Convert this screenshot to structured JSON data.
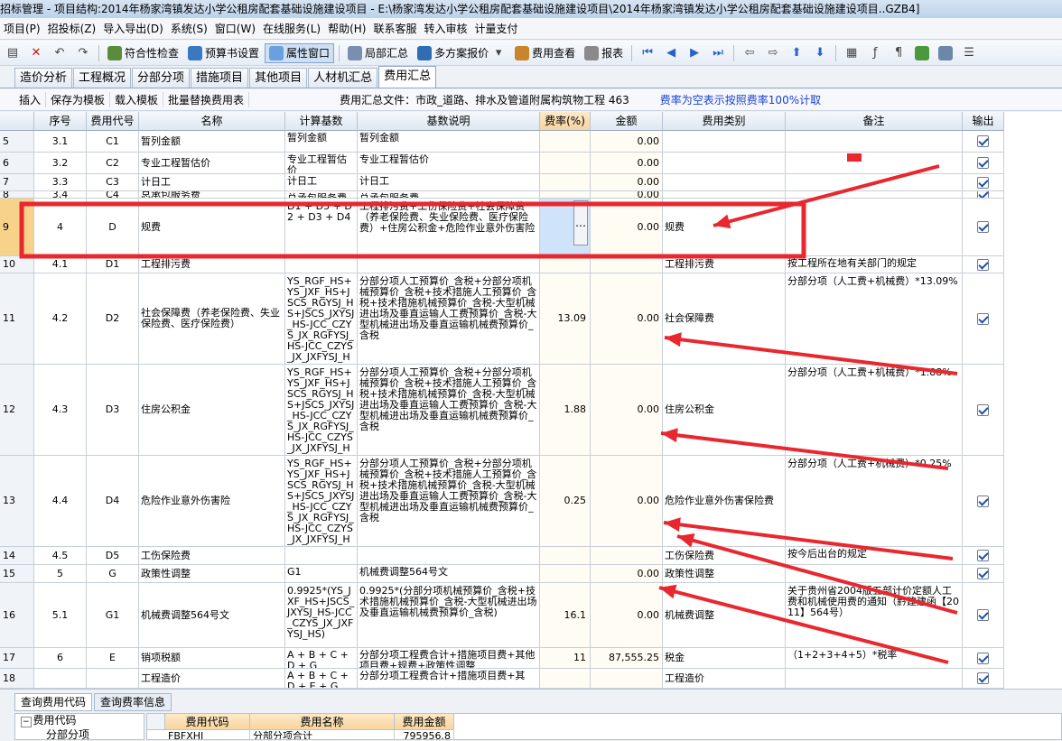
{
  "window_title": "招标管理 - 项目结构:2014年杨家湾镇发达小学公租房配套基础设施建设项目 - E:\\杨家湾发达小学公租房配套基础设施建设项目\\2014年杨家湾镇发达小学公租房配套基础设施建设项目..GZB4]",
  "menu": [
    "项目(P)",
    "招投标(Z)",
    "导入导出(D)",
    "系统(S)",
    "窗口(W)",
    "在线服务(L)",
    "帮助(H)",
    "联系客服",
    "转入审核",
    "计量支付"
  ],
  "toolbar": [
    "符合性检查",
    "预算书设置",
    "属性窗口",
    "局部汇总",
    "多方案报价",
    "费用查看",
    "报表"
  ],
  "tabs": [
    "造价分析",
    "工程概况",
    "分部分项",
    "措施项目",
    "其他项目",
    "人材机汇总",
    "费用汇总"
  ],
  "subbar": {
    "buttons": [
      "插入",
      "保存为模板",
      "载入模板",
      "批量替换费用表"
    ],
    "file_label": "费用汇总文件：市政_道路、排水及管道附属构筑物工程 463",
    "note": "费率为空表示按照费率100%计取"
  },
  "columns": [
    "序号",
    "费用代号",
    "名称",
    "计算基数",
    "基数说明",
    "费率(%)",
    "金额",
    "费用类别",
    "备注",
    "输出"
  ],
  "rows": [
    {
      "rn": "5",
      "seq": "3.1",
      "code": "C1",
      "name": "暂列金额",
      "base": "暂列金额",
      "desc": "暂列金额",
      "rate": "",
      "amount": "0.00",
      "cat": "",
      "note": ""
    },
    {
      "rn": "6",
      "seq": "3.2",
      "code": "C2",
      "name": "专业工程暂估价",
      "base": "专业工程暂估价",
      "desc": "专业工程暂估价",
      "rate": "",
      "amount": "0.00",
      "cat": "",
      "note": ""
    },
    {
      "rn": "7",
      "seq": "3.3",
      "code": "C3",
      "name": "计日工",
      "base": "计日工",
      "desc": "计日工",
      "rate": "",
      "amount": "0.00",
      "cat": "",
      "note": ""
    },
    {
      "rn": "8",
      "seq": "3.4",
      "code": "C4",
      "name": "总承包服务费",
      "base": "总承包服务费",
      "desc": "总承包服务费",
      "rate": "",
      "amount": "0.00",
      "cat": "",
      "note": ""
    },
    {
      "rn": "9",
      "seq": "4",
      "code": "D",
      "name": "规费",
      "base": "D1 + D5 + D2 + D3 + D4",
      "desc": "工程排污费+工伤保险费+社会保障费（养老保险费、失业保险费、医疗保险费）+住房公积金+危险作业意外伤害险",
      "rate": "",
      "amount": "0.00",
      "cat": "规费",
      "note": ""
    },
    {
      "rn": "10",
      "seq": "4.1",
      "code": "D1",
      "name": "工程排污费",
      "base": "",
      "desc": "",
      "rate": "",
      "amount": "",
      "cat": "工程排污费",
      "note": "按工程所在地有关部门的规定"
    },
    {
      "rn": "11",
      "seq": "4.2",
      "code": "D2",
      "name": "社会保障费（养老保险费、失业保险费、医疗保险费）",
      "base": "YS_RGF_HS+YS_JXF_HS+JSCS_RGYSJ_HS+JSCS_JXYSJ_HS-JCC_CZYS_JX_RGFYSJ_HS-JCC_CZYS_JX_JXFYSJ_HS",
      "desc": "分部分项人工预算价_含税+分部分项机械预算价_含税+技术措施人工预算价_含税+技术措施机械预算价_含税-大型机械进出场及垂直运输人工费预算价_含税-大型机械进出场及垂直运输机械费预算价_含税",
      "rate": "13.09",
      "amount": "0.00",
      "cat": "社会保障费",
      "note": "分部分项（人工费+机械费）*13.09%"
    },
    {
      "rn": "12",
      "seq": "4.3",
      "code": "D3",
      "name": "住房公积金",
      "base": "YS_RGF_HS+YS_JXF_HS+JSCS_RGYSJ_HS+JSCS_JXYSJ_HS-JCC_CZYS_JX_RGFYSJ_HS-JCC_CZYS_JX_JXFYSJ_HS",
      "desc": "分部分项人工预算价_含税+分部分项机械预算价_含税+技术措施人工预算价_含税+技术措施机械预算价_含税-大型机械进出场及垂直运输人工费预算价_含税-大型机械进出场及垂直运输机械费预算价_含税",
      "rate": "1.88",
      "amount": "0.00",
      "cat": "住房公积金",
      "note": "分部分项（人工费+机械费）*1.88%"
    },
    {
      "rn": "13",
      "seq": "4.4",
      "code": "D4",
      "name": "危险作业意外伤害险",
      "base": "YS_RGF_HS+YS_JXF_HS+JSCS_RGYSJ_HS+JSCS_JXYSJ_HS-JCC_CZYS_JX_RGFYSJ_HS-JCC_CZYS_JX_JXFYSJ_HS",
      "desc": "分部分项人工预算价_含税+分部分项机械预算价_含税+技术措施人工预算价_含税+技术措施机械预算价_含税-大型机械进出场及垂直运输人工费预算价_含税-大型机械进出场及垂直运输机械费预算价_含税",
      "rate": "0.25",
      "amount": "0.00",
      "cat": "危险作业意外伤害保险费",
      "note": "分部分项（人工费+机械费）*0.25%"
    },
    {
      "rn": "14",
      "seq": "4.5",
      "code": "D5",
      "name": "工伤保险费",
      "base": "",
      "desc": "",
      "rate": "",
      "amount": "",
      "cat": "工伤保险费",
      "note": "按今后出台的规定"
    },
    {
      "rn": "15",
      "seq": "5",
      "code": "G",
      "name": "政策性调整",
      "base": "G1",
      "desc": "机械费调整564号文",
      "rate": "",
      "amount": "0.00",
      "cat": "政策性调整",
      "note": ""
    },
    {
      "rn": "16",
      "seq": "5.1",
      "code": "G1",
      "name": "机械费调整564号文",
      "base": "0.9925*(YS_JXF_HS+JSCS_JXYSJ_HS-JCC_CZYS_JX_JXFYSJ_HS)",
      "desc": "0.9925*(分部分项机械预算价_含税+技术措施机械预算价_含税-大型机械进出场及垂直运输机械费预算价_含税)",
      "rate": "16.1",
      "amount": "0.00",
      "cat": "机械费调整",
      "note": "关于贵州省2004版五部计价定额人工费和机械使用费的通知（黔建建函【2011】564号）"
    },
    {
      "rn": "17",
      "seq": "6",
      "code": "E",
      "name": "销项税额",
      "base": "A + B + C + D + G",
      "desc": "分部分项工程费合计+措施项目费+其他项目费+规费+政策性调整",
      "rate": "11",
      "amount": "87,555.25",
      "cat": "税金",
      "note": "（1+2+3+4+5）*税率"
    },
    {
      "rn": "18",
      "seq": "",
      "code": "",
      "name": "工程造价",
      "base": "A + B + C + D + E + G",
      "desc": "分部分项工程费合计+措施项目费+其",
      "rate": "",
      "amount": "",
      "cat": "工程造价",
      "note": ""
    }
  ],
  "bottom": {
    "tabs": [
      "查询费用代码",
      "查询费率信息"
    ],
    "tree_root": "费用代码",
    "tree_child": "分部分项",
    "table_headers": [
      "费用代码",
      "费用名称",
      "费用金额"
    ],
    "table_row": [
      "FBFXHJ",
      "分部分项合计",
      "795956.8"
    ]
  },
  "colors": {
    "highlight_box": "#e8272f",
    "arrow": "#e8272f",
    "rate_header": "#f7d59e",
    "title_bar": "#bcd2ea",
    "selected_cell": "#cfe3fb"
  }
}
